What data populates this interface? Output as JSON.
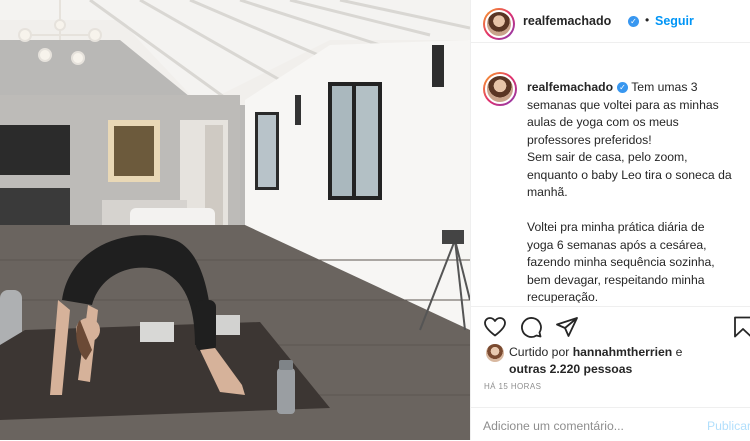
{
  "post": {
    "username": "realfemachado",
    "follow_label": "Seguir",
    "separator": "•",
    "caption": {
      "username": "realfemachado",
      "paragraph1": [
        "Tem umas 3",
        "semanas que voltei para as minhas",
        "aulas de yoga com os meus",
        "professores preferidos!",
        "Sem sair de casa, pelo zoom,",
        "enquanto o baby Leo tira o soneca da",
        "manhã."
      ],
      "paragraph2": [
        "Voltei pra minha prática diária de",
        "yoga 6 semanas após a cesárea,",
        "fazendo minha sequência sozinha,",
        "bem devagar, respeitando minha",
        "recuperação."
      ]
    },
    "likes": {
      "prefix": "Curtido por",
      "liker": "hannahmtherrien",
      "conjunction": "e",
      "others": "outras 2.220 pessoas"
    },
    "timestamp": "HÁ 15 HORAS",
    "comment_placeholder": "Adicione um comentário...",
    "publish_label": "Publicar"
  },
  "icons": {
    "verified": "verified-badge",
    "like": "heart-icon",
    "comment": "comment-icon",
    "share": "share-icon",
    "save": "bookmark-icon"
  },
  "colors": {
    "accent": "#0095f6",
    "verified": "#3897f0",
    "muted": "#8e8e8e",
    "text": "#262626"
  }
}
